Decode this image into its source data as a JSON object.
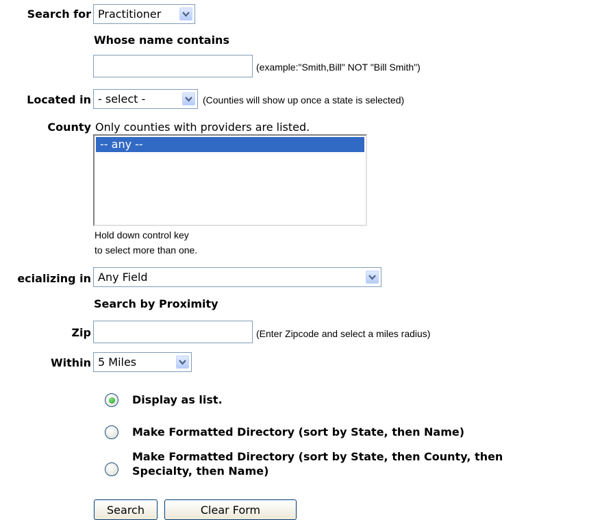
{
  "search_for": {
    "label": "Search for",
    "value": "Practitioner"
  },
  "name_contains": {
    "heading": "Whose name contains",
    "value": "",
    "hint": "(example:\"Smith,Bill\" NOT \"Bill Smith\")"
  },
  "located_in": {
    "label": "Located in",
    "value": "- select -",
    "hint": "(Counties will show up once a state is selected)"
  },
  "county": {
    "label": "County",
    "note": "Only counties with providers are listed.",
    "options": [
      "-- any --"
    ],
    "selected": "-- any --",
    "help_line1": "Hold down control key",
    "help_line2": "to select more than one."
  },
  "specializing_in": {
    "label": "ecializing in",
    "value": "Any Field"
  },
  "proximity": {
    "heading": "Search by Proximity",
    "zip_label": "Zip",
    "zip_value": "",
    "zip_hint": "(Enter Zipcode and select a miles radius)",
    "within_label": "Within",
    "within_value": "5 Miles"
  },
  "output_options": [
    {
      "label": "Display as list.",
      "selected": true
    },
    {
      "label": "Make Formatted Directory (sort by State, then Name)",
      "selected": false
    },
    {
      "label_line1": "Make Formatted Directory (sort by State, then County, then",
      "label_line2": "Specialty, then Name)",
      "selected": false
    }
  ],
  "buttons": {
    "search": "Search",
    "clear": "Clear Form"
  },
  "colors": {
    "selection": "#316ac5",
    "border": "#7f9db9",
    "dropdown_arrow": "#4d6185"
  }
}
